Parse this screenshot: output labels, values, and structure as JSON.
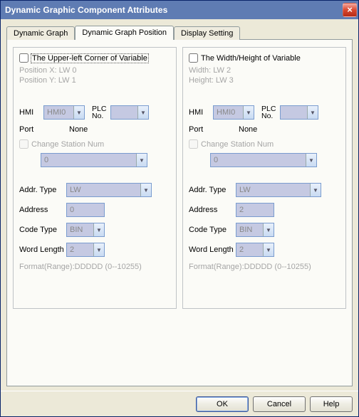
{
  "window": {
    "title": "Dynamic Graphic Component Attributes"
  },
  "tabs": {
    "0": "Dynamic Graph",
    "1": "Dynamic Graph Position",
    "2": "Display Setting"
  },
  "left": {
    "checkbox_label": "The Upper-left Corner of Variable",
    "info_line1": "Position X: LW 0",
    "info_line2": "Position Y: LW 1",
    "hmi_label": "HMI",
    "hmi_value": "HMI0",
    "plc_label": "PLC No.",
    "plc_value": "",
    "port_label": "Port",
    "port_value": "None",
    "change_station": "Change Station Num",
    "station_value": "0",
    "addr_type_label": "Addr. Type",
    "addr_type_value": "LW",
    "address_label": "Address",
    "address_value": "0",
    "code_type_label": "Code Type",
    "code_type_value": "BIN",
    "word_length_label": "Word Length",
    "word_length_value": "2",
    "format_text": "Format(Range):DDDDD (0--10255)"
  },
  "right": {
    "checkbox_label": "The Width/Height of Variable",
    "info_line1": "Width:  LW 2",
    "info_line2": "Height: LW 3",
    "hmi_label": "HMI",
    "hmi_value": "HMI0",
    "plc_label": "PLC No.",
    "plc_value": "",
    "port_label": "Port",
    "port_value": "None",
    "change_station": "Change Station Num",
    "station_value": "0",
    "addr_type_label": "Addr. Type",
    "addr_type_value": "LW",
    "address_label": "Address",
    "address_value": "2",
    "code_type_label": "Code Type",
    "code_type_value": "BIN",
    "word_length_label": "Word Length",
    "word_length_value": "2",
    "format_text": "Format(Range):DDDDD (0--10255)"
  },
  "buttons": {
    "ok": "OK",
    "cancel": "Cancel",
    "help": "Help"
  }
}
